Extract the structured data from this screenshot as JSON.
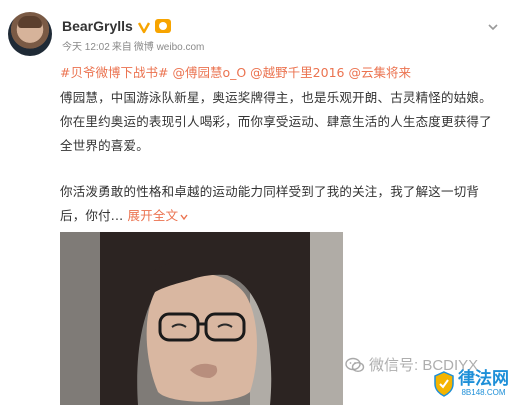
{
  "post": {
    "user": {
      "name": "BearGrylls",
      "verified_icon": "verified-v-badge-icon",
      "vip_icon": "weibo-vip-badge-icon"
    },
    "meta": {
      "time": "今天 12:02",
      "source_prefix": "来自",
      "source": "微博 weibo.com"
    },
    "mentions": {
      "topic": "#贝爷微博下战书#",
      "mention_1": "@傅园慧o_O",
      "mention_2": "@越野千里2016",
      "mention_3": "@云集将来"
    },
    "paragraph_1": "傅园慧，中国游泳队新星，奥运奖牌得主，也是乐观开朗、古灵精怪的姑娘。你在里约奥运的表现引人喝彩，而你享受运动、肆意生活的人生态度更获得了全世界的喜爱。",
    "paragraph_2": "你活泼勇敢的性格和卓越的运动能力同样受到了我的关注，我了解这一切背后，你付...",
    "expand_label": "展开全文"
  },
  "watermark": {
    "text": "微信号: BCDIYX",
    "icon": "wechat-icon"
  },
  "site_logo": {
    "name": "律法网",
    "domain": "8B148.COM",
    "icon": "shield-icon"
  },
  "colors": {
    "link": "#eb7350",
    "text": "#333333",
    "meta": "#8a8a8a",
    "logo_blue": "#1d8fd8",
    "vip_gold": "#f7a400"
  }
}
